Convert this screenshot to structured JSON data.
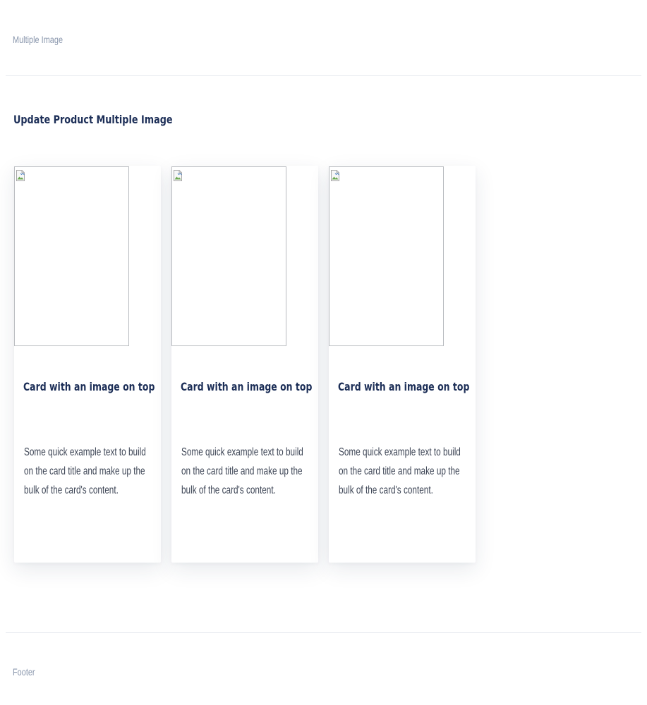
{
  "header": {
    "title": "Multiple Image"
  },
  "section": {
    "title": "Update Product Multiple Image"
  },
  "cards": [
    {
      "image_icon": "broken-image-icon",
      "title": "Card with an image on top",
      "text": "Some quick example text to build on the card title and make up the bulk of the card's content."
    },
    {
      "image_icon": "broken-image-icon",
      "title": "Card with an image on top",
      "text": "Some quick example text to build on the card title and make up the bulk of the card's content."
    },
    {
      "image_icon": "broken-image-icon",
      "title": "Card with an image on top",
      "text": "Some quick example text to build on the card title and make up the bulk of the card's content."
    }
  ],
  "footer": {
    "text": "Footer"
  },
  "colors": {
    "heading": "#1c2e57",
    "muted": "#8a97ad",
    "body_text": "#3e4656",
    "divider": "#e6e9ee",
    "image_border": "#b9bcc0"
  }
}
